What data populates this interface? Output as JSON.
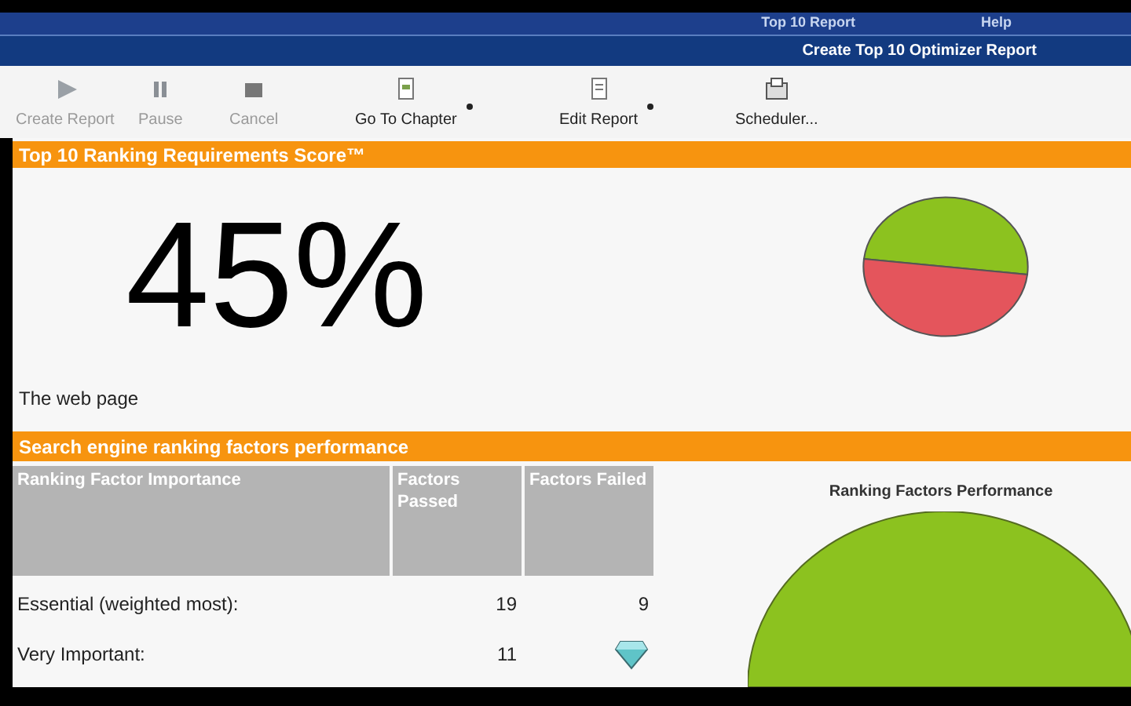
{
  "menu_bar": {
    "items": [
      "Top 10 Report",
      "Help"
    ]
  },
  "title_bar": {
    "title": "Create Top 10 Optimizer Report"
  },
  "toolbar": [
    {
      "label": "Create Report",
      "kind": "play",
      "disabled": true,
      "dropdown": false
    },
    {
      "label": "Pause",
      "kind": "pause",
      "disabled": true,
      "dropdown": false
    },
    {
      "label": "Cancel",
      "kind": "stop",
      "disabled": true,
      "dropdown": false
    },
    {
      "label": "Go To Chapter",
      "kind": "chapter",
      "disabled": false,
      "dropdown": true
    },
    {
      "label": "Edit Report",
      "kind": "edit",
      "disabled": false,
      "dropdown": true
    },
    {
      "label": "Scheduler...",
      "kind": "scheduler",
      "disabled": false,
      "dropdown": false
    }
  ],
  "score_panel": {
    "title": "Top 10 Ranking Requirements Score™",
    "score": "45%",
    "caption": "The web page"
  },
  "factors_panel": {
    "title": "Search engine ranking factors performance",
    "table": {
      "columns": [
        "Ranking Factor Importance",
        "Factors Passed",
        "Factors Failed"
      ],
      "rows": [
        {
          "cells": [
            "Essential (weighted most):",
            "19",
            "9"
          ]
        },
        {
          "cells": [
            "Very Important:",
            "11"
          ],
          "failed_covered": true
        }
      ]
    },
    "chart_title": "Ranking Factors Performance"
  }
}
